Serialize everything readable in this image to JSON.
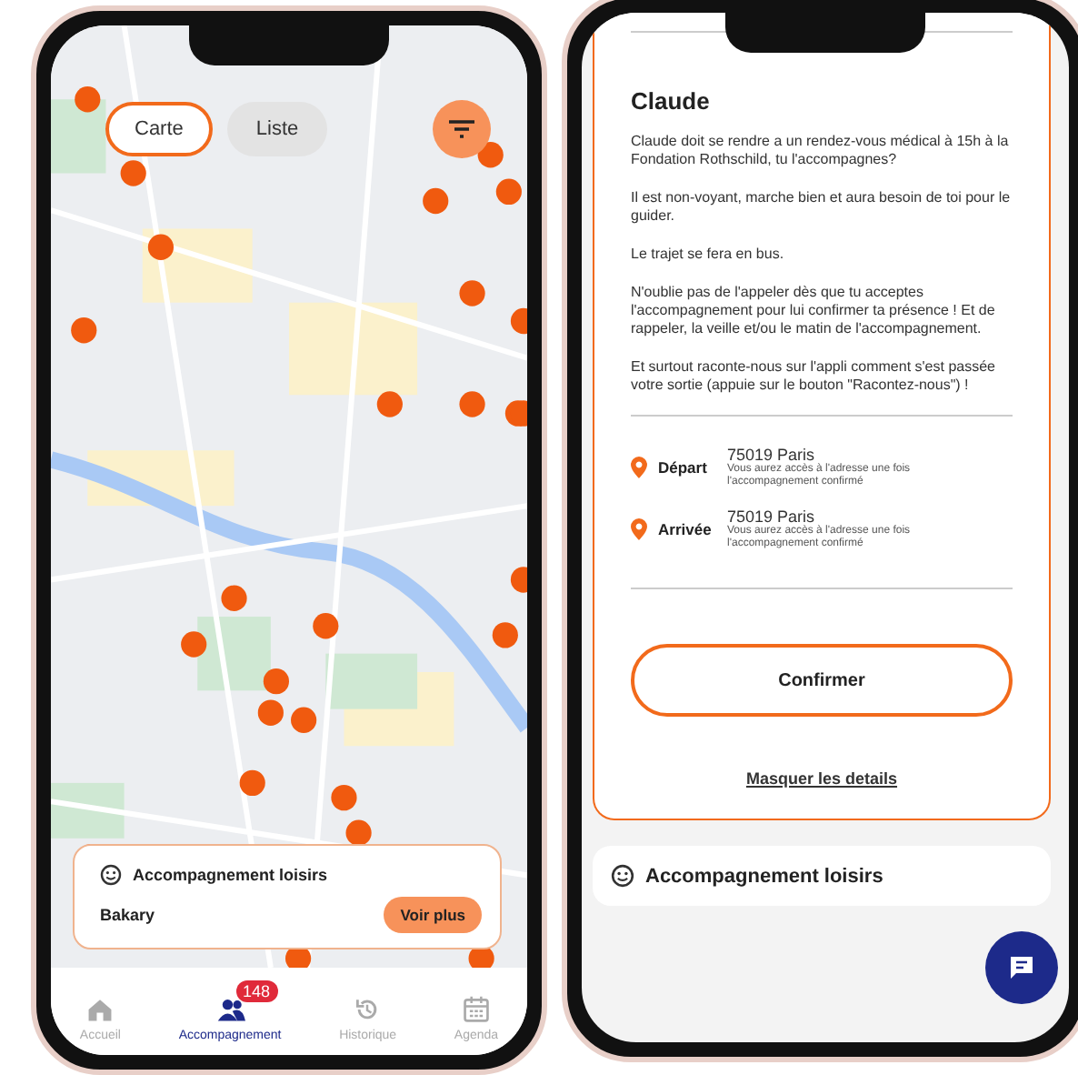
{
  "map_screen": {
    "view_toggle": [
      {
        "label": "Carte",
        "selected": true
      },
      {
        "label": "Liste",
        "selected": false
      }
    ],
    "card": {
      "title": "Accompagnement loisirs",
      "name": "Bakary",
      "button": "Voir plus"
    },
    "nav": [
      {
        "label": "Accueil",
        "selected": false
      },
      {
        "label": "Accompagnement",
        "selected": true,
        "badge": "148"
      },
      {
        "label": "Historique",
        "selected": false
      },
      {
        "label": "Agenda",
        "selected": false
      }
    ]
  },
  "detail_screen": {
    "title": "Claude",
    "paragraphs": [
      "Claude  doit se rendre a un rendez-vous médical à 15h à la Fondation Rothschild, tu l'accompagnes?",
      "Il est non-voyant, marche bien et aura besoin de toi pour le guider.",
      "Le trajet se fera en bus.",
      "N'oublie pas de l'appeler dès que tu acceptes l'accompagnement pour lui confirmer ta présence ! Et de rappeler, la veille et/ou le matin de l'accompagnement.",
      "Et surtout raconte-nous sur l'appli comment s'est passée votre sortie (appuie sur le bouton \"Racontez-nous\") !"
    ],
    "places": [
      {
        "label": "Départ",
        "city": "75019 Paris",
        "note": "Vous aurez accès à l'adresse une fois l'accompagnement confirmé"
      },
      {
        "label": "Arrivée",
        "city": "75019 Paris",
        "note": "Vous aurez accès à l'adresse une fois l'accompagnement confirmé"
      }
    ],
    "confirm_button": "Confirmer",
    "hide_link": "Masquer les details",
    "next_card_title": "Accompagnement loisirs"
  }
}
